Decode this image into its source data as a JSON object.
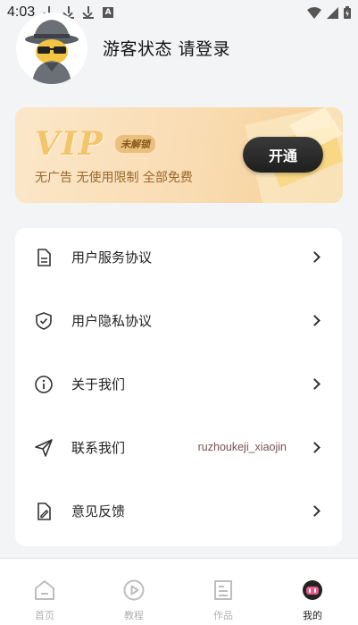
{
  "status_bar": {
    "time": "4:03",
    "a_icon": "A"
  },
  "header": {
    "login_text": "游客状态 请登录"
  },
  "vip_banner": {
    "title": "VIP",
    "badge": "未解锁",
    "subtitle": "无广告 无使用限制 全部免费",
    "button_label": "开通"
  },
  "menu": {
    "items": [
      {
        "label": "用户服务协议",
        "icon": "document-icon"
      },
      {
        "label": "用户隐私协议",
        "icon": "shield-check-icon"
      },
      {
        "label": "关于我们",
        "icon": "info-icon"
      },
      {
        "label": "联系我们",
        "icon": "send-icon",
        "extra": "ruzhoukeji_xiaojin"
      },
      {
        "label": "意见反馈",
        "icon": "edit-document-icon"
      }
    ]
  },
  "bottom_nav": {
    "items": [
      {
        "label": "首页",
        "icon": "home-icon",
        "active": false
      },
      {
        "label": "教程",
        "icon": "play-icon",
        "active": false
      },
      {
        "label": "作品",
        "icon": "works-icon",
        "active": false
      },
      {
        "label": "我的",
        "icon": "profile-icon",
        "active": true
      }
    ]
  },
  "colors": {
    "accent": "#222222",
    "vip_gold": "#f2c56a",
    "inactive": "#b0b0b0"
  }
}
